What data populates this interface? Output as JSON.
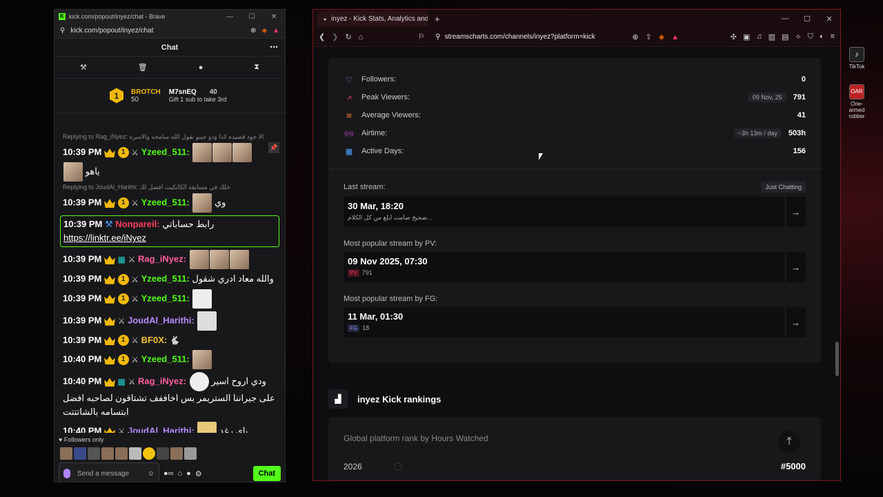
{
  "desktop": {
    "icons": [
      {
        "label": "TikTok",
        "glyph": "♪"
      },
      {
        "label": "One-armed robber",
        "glyph": "OAR"
      }
    ]
  },
  "left_window": {
    "title": "kick.com/popout/inyez/chat - Brave",
    "url": "kick.com/popout/inyez/chat",
    "chat_title": "Chat",
    "gift": {
      "rank": "1",
      "top_name": "BROTCH",
      "top_count": "50",
      "second_name": "M7snEQ",
      "second_count": "40",
      "cta": "Gift 1 sub to take 3rd"
    },
    "messages": [
      {
        "type": "reply",
        "text": "Replying to Rag_iNyez: الا جود قصيده كذا ودو جيبو نقول الله سامحه والاسره"
      },
      {
        "type": "msg",
        "time": "10:39 PM",
        "user": "Yzeed_511:",
        "color": "green",
        "text": "ياهو"
      },
      {
        "type": "reply",
        "text": "Replying to JoudAl_Harithi: خلك في مسابقة الكاتكيت افضل لك"
      },
      {
        "type": "msg",
        "time": "10:39 PM",
        "user": "Yzeed_511:",
        "color": "green",
        "text": "وي"
      },
      {
        "type": "highlight",
        "time": "10:39 PM",
        "user": "Nonpareil:",
        "color": "red",
        "text": "رابط حساباتي",
        "link": "https://linktr.ee/iNyez"
      },
      {
        "type": "msg",
        "time": "10:39 PM",
        "user": "Rag_iNyez:",
        "color": "pink",
        "text": ""
      },
      {
        "type": "msg",
        "time": "10:39 PM",
        "user": "Yzeed_511:",
        "color": "green",
        "text": "والله معاد ادري شقول"
      },
      {
        "type": "msg",
        "time": "10:39 PM",
        "user": "Yzeed_511:",
        "color": "green",
        "text": ""
      },
      {
        "type": "msg",
        "time": "10:39 PM",
        "user": "JoudAl_Harithi:",
        "color": "purple",
        "text": ""
      },
      {
        "type": "msg",
        "time": "10:39 PM",
        "user": "BF0X:",
        "color": "yellow",
        "text": ""
      },
      {
        "type": "msg",
        "time": "10:40 PM",
        "user": "Yzeed_511:",
        "color": "green",
        "text": ""
      },
      {
        "type": "msg",
        "time": "10:40 PM",
        "user": "Rag_iNyez:",
        "color": "pink",
        "text": "ودي اروح اسير على جيراننا الستريمر بس اخاففف تشتاقون لصاحبه افضل ابتسامه بالشاتتتت"
      },
      {
        "type": "msg",
        "time": "10:40 PM",
        "user": "JoudAl_Harithi:",
        "color": "purple",
        "text": "باي رغد"
      }
    ],
    "followers_only": "Followers only",
    "input_placeholder": "Send a message",
    "chat_button": "Chat"
  },
  "right_window": {
    "tab_title": "inyez - Kick Stats, Analytics and",
    "url": "streamscharts.com/channels/inyez?platform=kick",
    "stats": [
      {
        "icon": "heart-icon",
        "glyph": "♡",
        "label": "Followers:",
        "chip": "",
        "value": "0"
      },
      {
        "icon": "peak-icon",
        "glyph": "⩘",
        "label": "Peak Viewers:",
        "chip": "09 Nov, 25",
        "value": "791"
      },
      {
        "icon": "avg-icon",
        "glyph": "≋",
        "label": "Average Viewers:",
        "chip": "",
        "value": "41"
      },
      {
        "icon": "airtime-icon",
        "glyph": "((•))",
        "label": "Airtime:",
        "chip": "~3h 13m / day",
        "value": "503h"
      },
      {
        "icon": "calendar-icon",
        "glyph": "▦",
        "label": "Active Days:",
        "chip": "",
        "value": "156"
      }
    ],
    "last_stream": {
      "label": "Last stream:",
      "tag": "Just Chatting",
      "date": "30 Mar, 18:20",
      "title": "ضجيج صامت ابلغ من كل الكلام..."
    },
    "popular_pv": {
      "label": "Most popular stream by PV:",
      "date": "09 Nov 2025, 07:30",
      "badge": "PV",
      "value": "791"
    },
    "popular_fg": {
      "label": "Most popular stream by FG:",
      "date": "11 Mar, 01:30",
      "badge": "FG",
      "value": "18"
    },
    "rankings_title": "inyez Kick rankings",
    "rank_card": {
      "label": "Global platform rank by Hours Watched",
      "year": "2026",
      "rank": "#5000"
    }
  }
}
